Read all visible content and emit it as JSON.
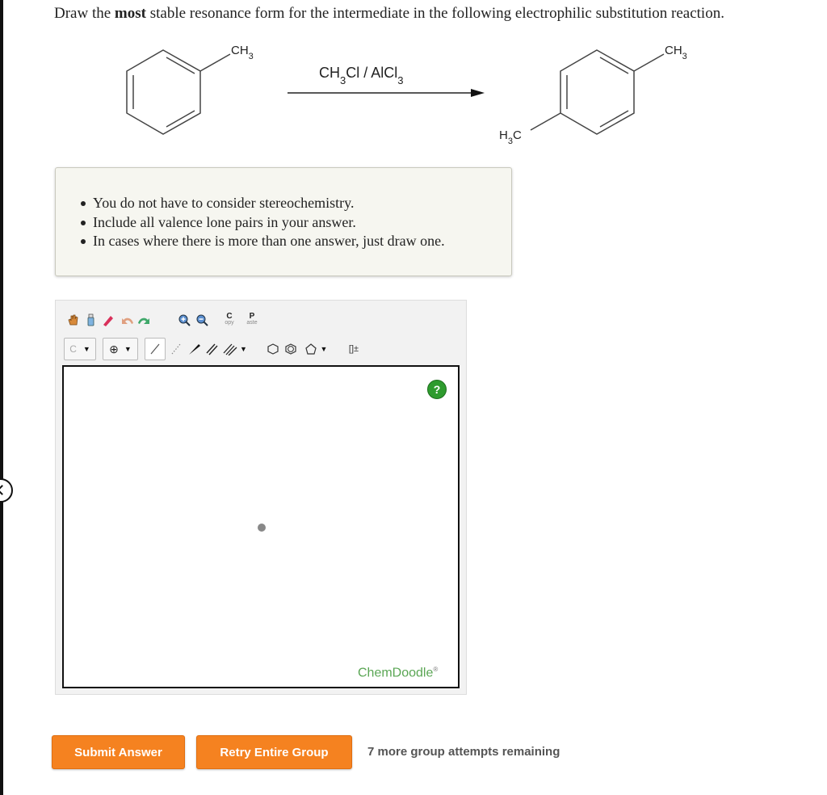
{
  "question": {
    "prefix": "Draw the",
    "emphasis": "most",
    "suffix": "stable resonance form for the intermediate in the following electrophilic substitution reaction."
  },
  "reaction": {
    "reactant_substituent": "CH3",
    "reagents": "CH3Cl / AlCl3",
    "product_substituent_top": "CH3",
    "product_substituent_bottom": "H3C"
  },
  "instructions": [
    "You do not have to consider stereochemistry.",
    "Include all valence lone pairs in your answer.",
    "In cases where there is more than one answer, just draw one."
  ],
  "toolbar": {
    "copy_top": "C",
    "copy_bottom": "opy",
    "paste_top": "P",
    "paste_bottom": "aste",
    "element": "C",
    "charge": "⊕",
    "bracket": "[]±"
  },
  "editor": {
    "help": "?",
    "brand": "ChemDoodle",
    "brand_mark": "®"
  },
  "actions": {
    "submit": "Submit Answer",
    "retry": "Retry Entire Group",
    "attempts": "7 more group attempts remaining"
  },
  "colors": {
    "button": "#f58220",
    "help": "#2e9b2e",
    "brand": "#5aa654"
  }
}
